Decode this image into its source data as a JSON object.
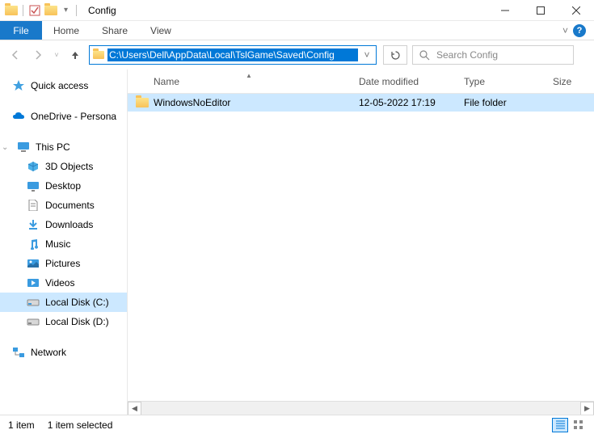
{
  "window": {
    "title": "Config"
  },
  "ribbon": {
    "file": "File",
    "tabs": [
      "Home",
      "Share",
      "View"
    ]
  },
  "address": {
    "path": "C:\\Users\\Dell\\AppData\\Local\\TslGame\\Saved\\Config"
  },
  "search": {
    "placeholder": "Search Config"
  },
  "navpane": {
    "quick_access": "Quick access",
    "onedrive": "OneDrive - Persona",
    "this_pc": "This PC",
    "items": [
      "3D Objects",
      "Desktop",
      "Documents",
      "Downloads",
      "Music",
      "Pictures",
      "Videos",
      "Local Disk (C:)",
      "Local Disk (D:)"
    ],
    "network": "Network"
  },
  "columns": {
    "name": "Name",
    "date": "Date modified",
    "type": "Type",
    "size": "Size"
  },
  "files": [
    {
      "name": "WindowsNoEditor",
      "date": "12-05-2022 17:19",
      "type": "File folder",
      "size": ""
    }
  ],
  "status": {
    "count": "1 item",
    "selected": "1 item selected"
  }
}
